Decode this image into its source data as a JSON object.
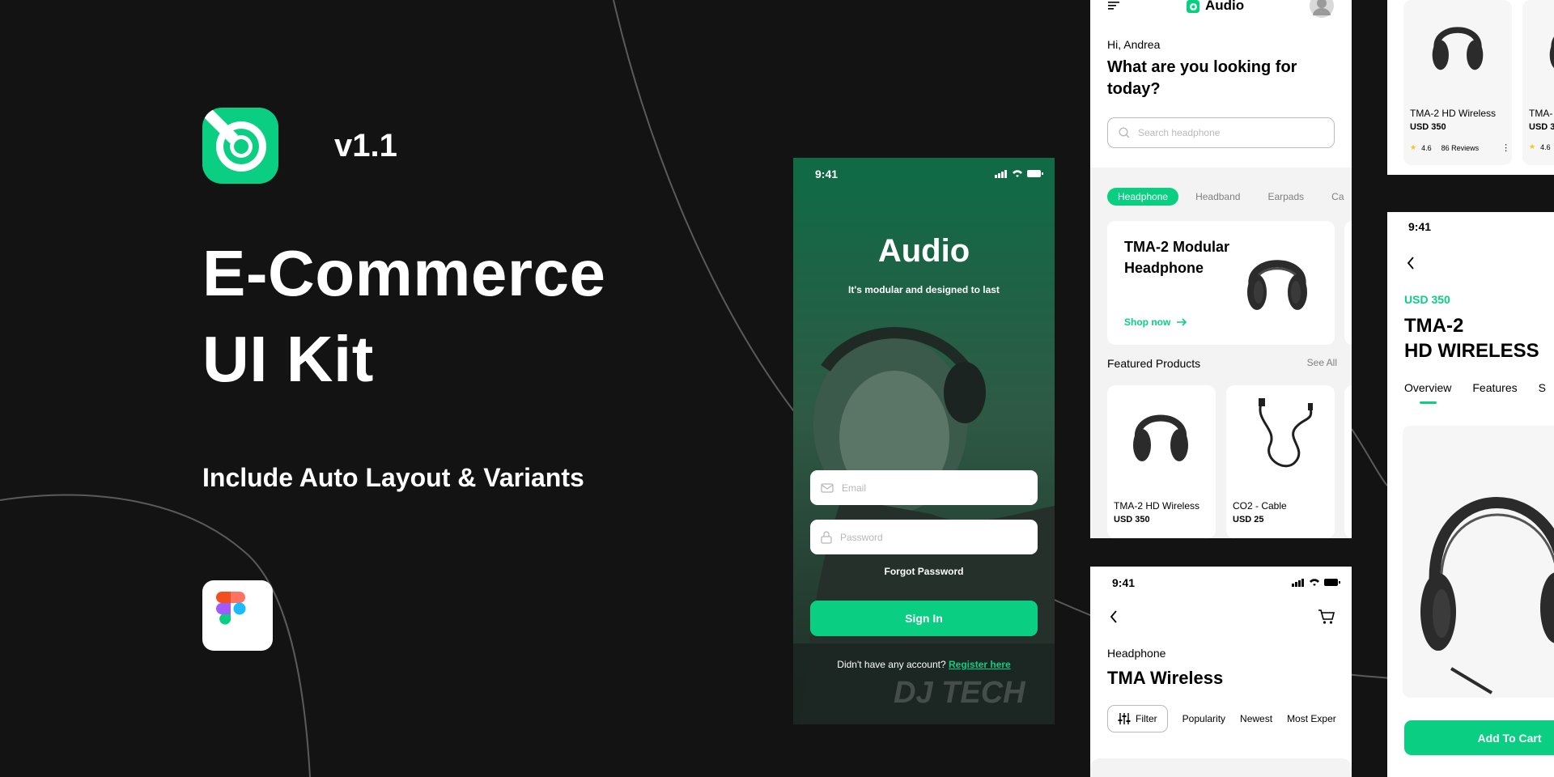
{
  "hero": {
    "version": "v1.1",
    "headline_line1": "E-Commerce",
    "headline_line2": "UI Kit",
    "subline": "Include Auto Layout & Variants",
    "brand_color": "#0ACF83",
    "background_color": "#131314"
  },
  "signin": {
    "time": "9:41",
    "title": "Audio",
    "tagline": "It's modular and designed to last",
    "email_placeholder": "Email",
    "password_placeholder": "Password",
    "forgot": "Forgot Password",
    "signin_button": "Sign In",
    "register_prompt": "Didn't have any account?",
    "register_link": "Register here",
    "photo_watermark": "DJ TECH"
  },
  "home": {
    "app_name": "Audio",
    "greeting": "Hi, Andrea",
    "question": "What are you looking for today?",
    "search_placeholder": "Search headphone",
    "categories": [
      "Headphone",
      "Headband",
      "Earpads",
      "Ca"
    ],
    "banner_title": "TMA-2 Modular Headphone",
    "shop_now": "Shop now",
    "featured_title": "Featured Products",
    "see_all": "See All",
    "products": [
      {
        "name": "TMA-2 HD Wireless",
        "price": "USD 350"
      },
      {
        "name": "CO2 - Cable",
        "price": "USD 25"
      }
    ]
  },
  "list": {
    "time": "9:41",
    "category": "Headphone",
    "title": "TMA Wireless",
    "filter": "Filter",
    "sort_options": [
      "Popularity",
      "Newest",
      "Most Exper"
    ]
  },
  "grid": {
    "cards": [
      {
        "name": "TMA-2 HD Wireless",
        "price": "USD 350",
        "rating": "4.6",
        "reviews": "86 Reviews"
      },
      {
        "name": "TMA-",
        "price": "USD 3",
        "rating": "4.6"
      }
    ]
  },
  "detail": {
    "time": "9:41",
    "price": "USD 350",
    "title_line1": "TMA-2",
    "title_line2": "HD WIRELESS",
    "tabs": [
      "Overview",
      "Features",
      "S"
    ],
    "add_to_cart": "Add To Cart"
  }
}
